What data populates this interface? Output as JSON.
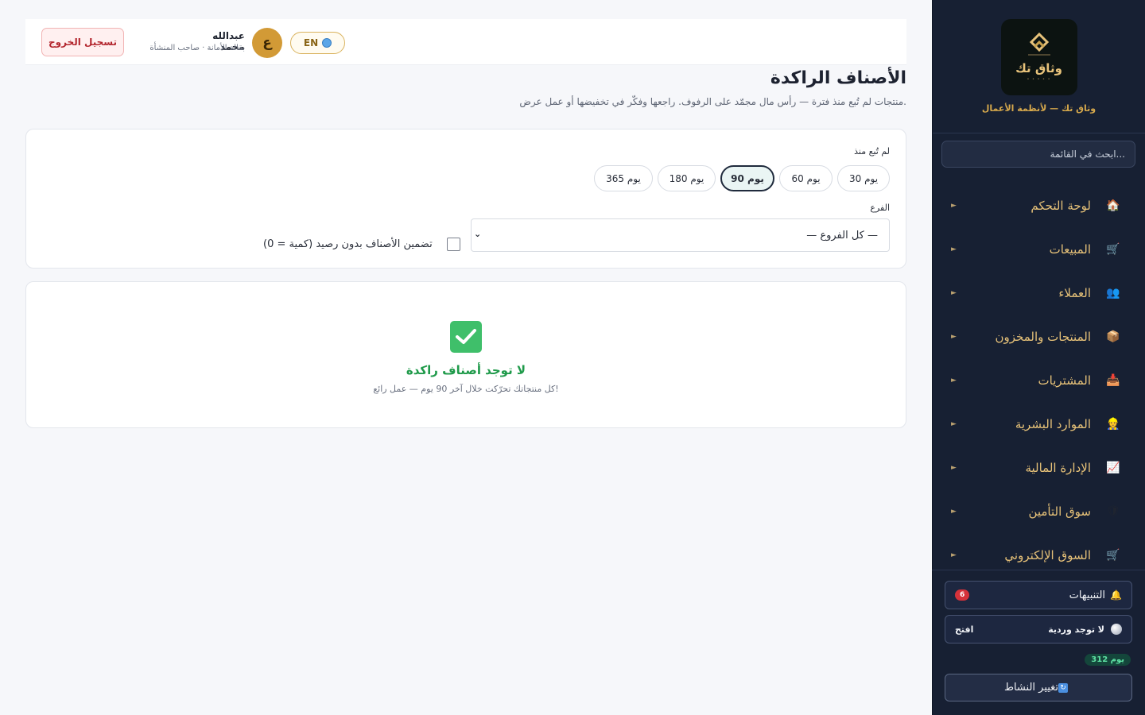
{
  "sidebar": {
    "brand_name": "وثاق تك",
    "brand_tagline": "وثاق تك — لأنظمة الأعمال",
    "search_placeholder": "ابحث في القائمة...",
    "items": [
      {
        "label": "لوحة التحكم",
        "icon": "house-icon",
        "glyph": "🏠"
      },
      {
        "label": "المبيعات",
        "icon": "cart-icon",
        "glyph": "🛒"
      },
      {
        "label": "العملاء",
        "icon": "users-icon",
        "glyph": "👥"
      },
      {
        "label": "المنتجات والمخزون",
        "icon": "package-icon",
        "glyph": "📦"
      },
      {
        "label": "المشتريات",
        "icon": "inbox-icon",
        "glyph": "📥"
      },
      {
        "label": "الموارد البشرية",
        "icon": "worker-icon",
        "glyph": "👷"
      },
      {
        "label": "الإدارة المالية",
        "icon": "chart-icon",
        "glyph": "📈"
      },
      {
        "label": "سوق التأمين",
        "icon": "shield-icon",
        "glyph": "🛡"
      },
      {
        "label": "السوق الإلكتروني",
        "icon": "shopping-cart-icon",
        "glyph": "🛒"
      }
    ],
    "arrow": "►",
    "notifications": {
      "label": "التنبيهات",
      "count": "6",
      "icon": "bell-icon",
      "glyph": "🔔"
    },
    "shift": {
      "text": "لا توجد وردية",
      "action": "افتح"
    },
    "days_badge": "312 يوم",
    "switch_activity": {
      "label": "تغيير النشاط",
      "glyph": "🔄"
    }
  },
  "header": {
    "logout_label": "تسجيل الخروج",
    "user_name": "عبدالله محمد",
    "user_subtitle": "بقالة الأمانة · صاحب المنشأة",
    "avatar_letter": "ع",
    "language_label": "EN"
  },
  "page": {
    "title": "الأصناف الراكدة",
    "subtitle": "منتجات لم تُبع منذ فترة — رأس مال مجمّد على الرفوف. راجعها وفكّر في تخفيضها أو عمل عرض."
  },
  "filters": {
    "period_label": "لم تُبع منذ",
    "periods": [
      {
        "label": "30 يوم",
        "active": false
      },
      {
        "label": "60 يوم",
        "active": false
      },
      {
        "label": "90 يوم",
        "active": true
      },
      {
        "label": "180 يوم",
        "active": false
      },
      {
        "label": "365 يوم",
        "active": false
      }
    ],
    "branch_label": "الفرع",
    "branch_value": "— كل الفروع —",
    "include_zero_label": "تضمين الأصناف بدون رصيد (كمية = 0)",
    "include_zero_checked": false
  },
  "empty_state": {
    "title": "لا توجد أصناف راكدة",
    "message": "كل منتجاتك تحرّكت خلال آخر 90 يوم — عمل رائع!"
  },
  "colors": {
    "sidebar_bg": "#172033",
    "accent_gold": "#e6c178",
    "success_green": "#1f9a4a",
    "danger_red": "#b3262e"
  }
}
